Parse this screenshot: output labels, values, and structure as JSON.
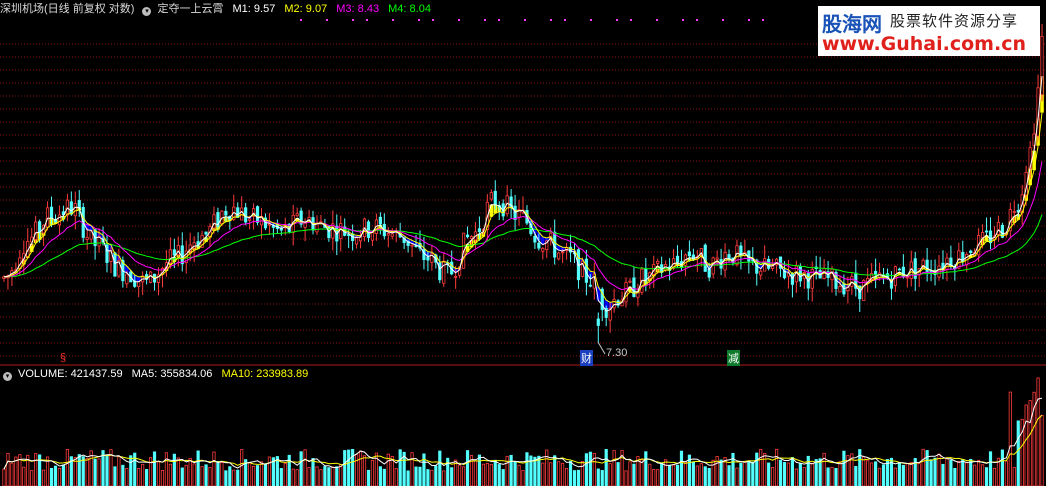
{
  "main_header": {
    "title": "深圳机场(日线 前复权 对数)",
    "indicator_name": "定夺一上云霄",
    "m1": "M1: 9.57",
    "m2": "M2: 9.07",
    "m3": "M3: 8.43",
    "m4": "M4: 8.04"
  },
  "volume_header": {
    "volume": "VOLUME: 421437.59",
    "ma5": "MA5: 355834.06",
    "ma10": "MA10: 233983.89"
  },
  "logo": {
    "brand": "股海网",
    "tagline": "股票软件资源分享",
    "url": "www.Guhai.com.cn"
  },
  "annotations": {
    "low_price": "7.30",
    "marker_left": "§",
    "marker_cai": "财",
    "marker_jian": "减"
  },
  "colors": {
    "background": "#000000",
    "up_candle": "#ff3c3c",
    "down_candle": "#54ffff",
    "m1": "#ffffff",
    "m2": "#ffff00",
    "m3": "#ff00ff",
    "m4": "#00ff00",
    "band_up": "#ffff00",
    "band_down": "#0000ff",
    "grid": "#8a1010",
    "volume_ma5": "#ffffff",
    "volume_ma10": "#ffff00"
  },
  "chart_data": [
    {
      "type": "candlestick",
      "title": "深圳机场(日线 前复权 对数)",
      "ylim": [
        7.1,
        11.6
      ],
      "y_scale": "log",
      "grid": true,
      "series": [
        {
          "name": "M1",
          "values": []
        },
        {
          "name": "M2",
          "values": []
        },
        {
          "name": "M3",
          "values": []
        },
        {
          "name": "M4",
          "values": []
        }
      ],
      "anchors": [
        [
          0,
          8.0
        ],
        [
          6,
          8.45
        ],
        [
          12,
          8.75
        ],
        [
          17,
          8.85
        ],
        [
          23,
          8.4
        ],
        [
          30,
          8.1
        ],
        [
          36,
          7.95
        ],
        [
          42,
          8.2
        ],
        [
          50,
          8.5
        ],
        [
          57,
          8.85
        ],
        [
          63,
          8.7
        ],
        [
          70,
          8.55
        ],
        [
          76,
          8.7
        ],
        [
          82,
          8.6
        ],
        [
          88,
          8.55
        ],
        [
          94,
          8.6
        ],
        [
          100,
          8.5
        ],
        [
          106,
          8.25
        ],
        [
          112,
          8.05
        ],
        [
          118,
          8.5
        ],
        [
          124,
          8.95
        ],
        [
          130,
          8.75
        ],
        [
          136,
          8.45
        ],
        [
          142,
          8.25
        ],
        [
          148,
          8.0
        ],
        [
          152,
          7.7
        ],
        [
          156,
          7.82
        ],
        [
          162,
          8.0
        ],
        [
          168,
          8.15
        ],
        [
          174,
          8.3
        ],
        [
          178,
          8.15
        ],
        [
          183,
          8.3
        ],
        [
          188,
          8.15
        ],
        [
          194,
          8.1
        ],
        [
          200,
          8.05
        ],
        [
          206,
          8.0
        ],
        [
          212,
          7.95
        ],
        [
          216,
          7.9
        ],
        [
          222,
          8.0
        ],
        [
          228,
          8.1
        ],
        [
          234,
          8.15
        ],
        [
          240,
          8.25
        ],
        [
          246,
          8.4
        ],
        [
          252,
          8.6
        ],
        [
          256,
          8.95
        ],
        [
          259,
          9.6
        ],
        [
          261,
          10.4
        ],
        [
          262,
          11.4
        ]
      ],
      "count": 263,
      "low_label": 7.3
    },
    {
      "type": "bar",
      "title": "VOLUME",
      "values_latest": {
        "volume": 421437.59,
        "ma5": 355834.06,
        "ma10": 233983.89
      },
      "series": [
        {
          "name": "MA5",
          "values": []
        },
        {
          "name": "MA10",
          "values": []
        }
      ]
    }
  ]
}
